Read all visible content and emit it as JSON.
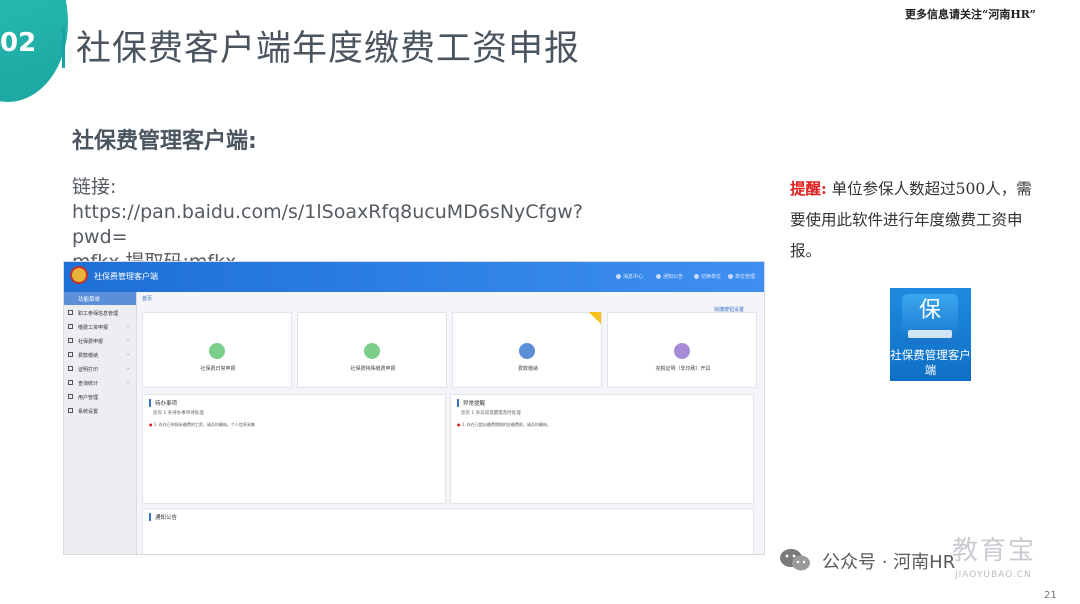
{
  "slide": {
    "number": "02",
    "title": "社保费客户端年度缴费工资申报",
    "top_right": "更多信息请关注“河南HR”",
    "subtitle": "社保费管理客户端:",
    "link_label": "链接:",
    "link_url": "https://pan.baidu.com/s/1lSoaxRfq8ucuMD6sNyCfgw?pwd=",
    "link_code": "mfkx 提取码:mfkx",
    "page_number": "21"
  },
  "reminder": {
    "label": "提醒:",
    "text": "单位参保人数超过500人，需要使用此软件进行年度缴费工资申报。"
  },
  "app_icon": {
    "glyph": "保",
    "caption": "社保费管理客户端"
  },
  "app": {
    "window_title": "社保费管理客户端",
    "top_nav": [
      "消息中心",
      "通知公告",
      "切换单位",
      "单位管理"
    ],
    "sidebar_header": "功能菜单",
    "sidebar_items": [
      "职工参保信息管理",
      "缴费工资申报",
      "社保费申报",
      "费款缴纳",
      "证明打印",
      "查询统计",
      "用户管理",
      "系统设置"
    ],
    "breadcrumb": "首页",
    "quick_link": "快捷按钮设置",
    "cards": [
      {
        "label": "社保费日常申报",
        "color": "#7ccf8a"
      },
      {
        "label": "社保费特殊缴费申报",
        "color": "#7ccf8a"
      },
      {
        "label": "费款缴纳",
        "color": "#5b8fd8"
      },
      {
        "label": "完税证明（非印刷）开具",
        "color": "#a58bd8"
      }
    ],
    "todo": {
      "title": "待办事项",
      "summary": "您有 1 条待办事项待处理",
      "item": "1. 存在已申报未缴费的工资，请及时缴纳。个人信息采集"
    },
    "alert": {
      "title": "异常提醒",
      "summary": "您有 1 条异常提醒需及时处理",
      "item": "1. 存在已超出缴费期限的应缴费款，请及时缴纳。"
    },
    "notice": {
      "title": "通知公告"
    }
  },
  "watermark": {
    "brand": "公众号 · 河南HR",
    "big": "教育宝",
    "site": "JIAOYUBAO.CN"
  }
}
